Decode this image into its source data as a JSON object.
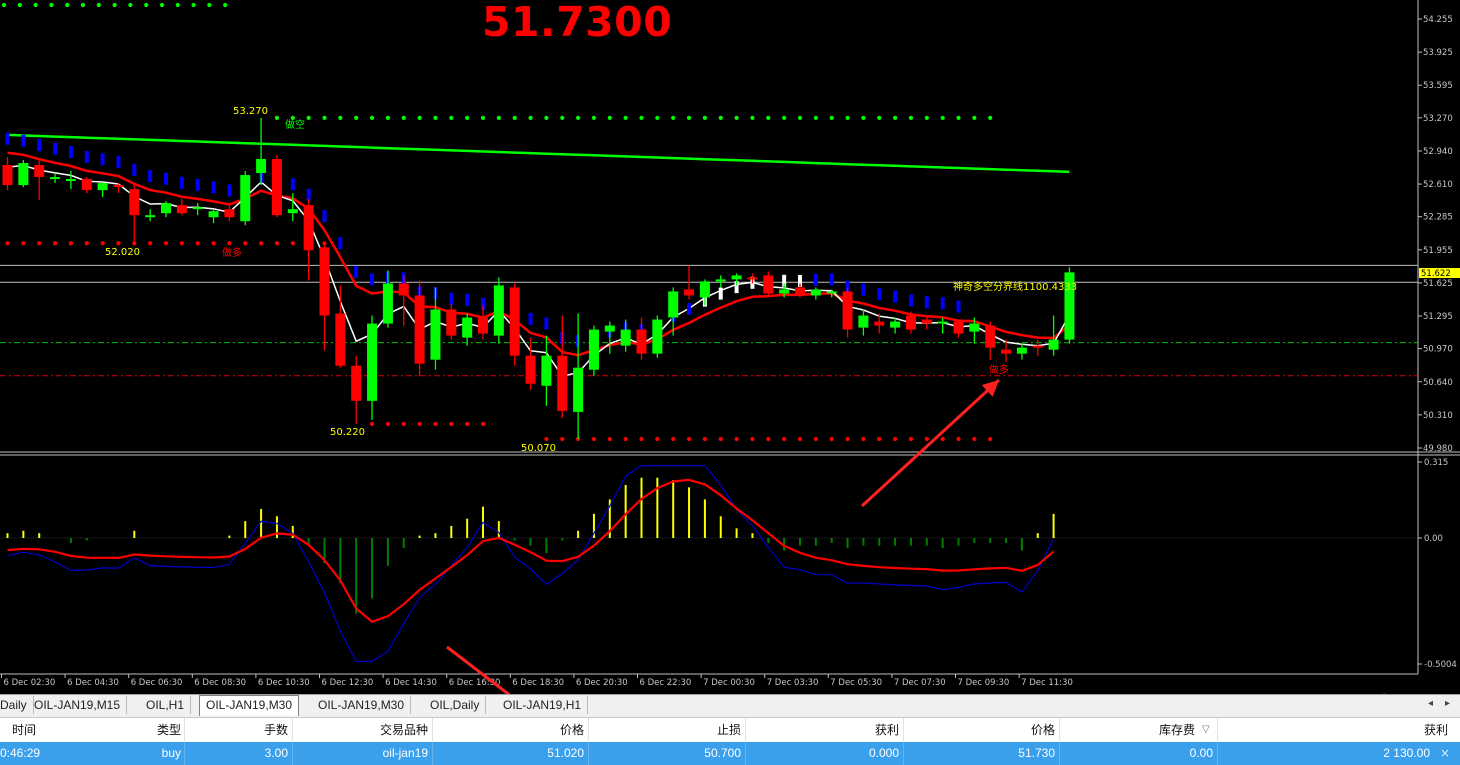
{
  "current_price": "51.7300",
  "colors": {
    "background": "#000000",
    "bull": "#00ff00",
    "bear": "#ff0000",
    "fast_ma": "#ffffff",
    "slow_ma": "#ff0000",
    "long_ma": "#00ff00",
    "blue_bars": "#0000ff",
    "macd_line": "#0000cc",
    "signal_line": "#ff0000",
    "hist_pos": "#ffff00",
    "hist_neg": "#008000",
    "annotation_text": "#ffff00",
    "arrow": "#ff2020",
    "selected_row": "#3ba0ec"
  },
  "price_axis": [
    "54.255",
    "53.925",
    "53.595",
    "53.270",
    "52.940",
    "52.610",
    "52.285",
    "51.955",
    "51.625",
    "51.295",
    "50.970",
    "50.640",
    "50.310",
    "49.980"
  ],
  "price_tag": "51.622",
  "price_tag_top": "51.730",
  "indicator_axis": [
    "0.315",
    "0.00",
    "-0.5004"
  ],
  "time_axis": [
    "6 Dec 02:30",
    "6 Dec 04:30",
    "6 Dec 06:30",
    "6 Dec 08:30",
    "6 Dec 10:30",
    "6 Dec 12:30",
    "6 Dec 14:30",
    "6 Dec 16:30",
    "6 Dec 18:30",
    "6 Dec 20:30",
    "6 Dec 22:30",
    "7 Dec 00:30",
    "7 Dec 03:30",
    "7 Dec 05:30",
    "7 Dec 07:30",
    "7 Dec 09:30",
    "7 Dec 11:30"
  ],
  "annotations": {
    "high_label": "53.270",
    "short_label_1": "做空",
    "low_label_1": "52.020",
    "long_label_1": "做多",
    "low_label_2": "50.220",
    "low_label_3": "50.070",
    "boundary_text": "神奇多空分界线1100.4333",
    "long_label_2": "做多"
  },
  "chart_data": {
    "type": "candlestick",
    "timeframe": "M30",
    "ylim": [
      49.98,
      54.255
    ],
    "candles": [
      {
        "o": 52.8,
        "h": 52.88,
        "l": 52.55,
        "c": 52.6
      },
      {
        "o": 52.6,
        "h": 52.85,
        "l": 52.58,
        "c": 52.82
      },
      {
        "o": 52.8,
        "h": 52.84,
        "l": 52.45,
        "c": 52.68
      },
      {
        "o": 52.68,
        "h": 52.72,
        "l": 52.62,
        "c": 52.68
      },
      {
        "o": 52.66,
        "h": 52.74,
        "l": 52.56,
        "c": 52.66
      },
      {
        "o": 52.66,
        "h": 52.68,
        "l": 52.52,
        "c": 52.55
      },
      {
        "o": 52.55,
        "h": 52.62,
        "l": 52.48,
        "c": 52.62
      },
      {
        "o": 52.6,
        "h": 52.62,
        "l": 52.52,
        "c": 52.58
      },
      {
        "o": 52.56,
        "h": 52.62,
        "l": 52.0,
        "c": 52.3
      },
      {
        "o": 52.3,
        "h": 52.36,
        "l": 52.24,
        "c": 52.3
      },
      {
        "o": 52.32,
        "h": 52.44,
        "l": 52.28,
        "c": 52.42
      },
      {
        "o": 52.4,
        "h": 52.46,
        "l": 52.3,
        "c": 52.32
      },
      {
        "o": 52.38,
        "h": 52.42,
        "l": 52.3,
        "c": 52.38
      },
      {
        "o": 52.28,
        "h": 52.36,
        "l": 52.22,
        "c": 52.34
      },
      {
        "o": 52.36,
        "h": 52.4,
        "l": 52.24,
        "c": 52.28
      },
      {
        "o": 52.24,
        "h": 52.74,
        "l": 52.2,
        "c": 52.7
      },
      {
        "o": 52.72,
        "h": 53.27,
        "l": 52.6,
        "c": 52.86
      },
      {
        "o": 52.86,
        "h": 52.9,
        "l": 52.28,
        "c": 52.3
      },
      {
        "o": 52.32,
        "h": 52.52,
        "l": 52.24,
        "c": 52.36
      },
      {
        "o": 52.4,
        "h": 52.46,
        "l": 51.65,
        "c": 51.95
      },
      {
        "o": 51.98,
        "h": 52.02,
        "l": 50.95,
        "c": 51.3
      },
      {
        "o": 51.32,
        "h": 51.6,
        "l": 50.78,
        "c": 50.8
      },
      {
        "o": 50.8,
        "h": 50.9,
        "l": 50.22,
        "c": 50.45
      },
      {
        "o": 50.45,
        "h": 51.3,
        "l": 50.26,
        "c": 51.22
      },
      {
        "o": 51.22,
        "h": 51.75,
        "l": 51.18,
        "c": 51.62
      },
      {
        "o": 51.62,
        "h": 51.7,
        "l": 51.2,
        "c": 51.5
      },
      {
        "o": 51.5,
        "h": 51.65,
        "l": 50.7,
        "c": 50.82
      },
      {
        "o": 50.86,
        "h": 51.58,
        "l": 50.76,
        "c": 51.36
      },
      {
        "o": 51.36,
        "h": 51.42,
        "l": 51.06,
        "c": 51.1
      },
      {
        "o": 51.08,
        "h": 51.32,
        "l": 51.0,
        "c": 51.28
      },
      {
        "o": 51.28,
        "h": 51.4,
        "l": 51.06,
        "c": 51.12
      },
      {
        "o": 51.1,
        "h": 51.68,
        "l": 51.02,
        "c": 51.6
      },
      {
        "o": 51.58,
        "h": 51.62,
        "l": 50.8,
        "c": 50.9
      },
      {
        "o": 50.9,
        "h": 51.08,
        "l": 50.56,
        "c": 50.62
      },
      {
        "o": 50.6,
        "h": 51.1,
        "l": 50.4,
        "c": 50.9
      },
      {
        "o": 50.9,
        "h": 51.3,
        "l": 50.28,
        "c": 50.35
      },
      {
        "o": 50.34,
        "h": 51.32,
        "l": 50.07,
        "c": 50.78
      },
      {
        "o": 50.76,
        "h": 51.2,
        "l": 50.7,
        "c": 51.16
      },
      {
        "o": 51.14,
        "h": 51.24,
        "l": 50.92,
        "c": 51.2
      },
      {
        "o": 51.0,
        "h": 51.26,
        "l": 50.94,
        "c": 51.16
      },
      {
        "o": 51.16,
        "h": 51.28,
        "l": 50.86,
        "c": 50.92
      },
      {
        "o": 50.92,
        "h": 51.3,
        "l": 50.88,
        "c": 51.26
      },
      {
        "o": 51.28,
        "h": 51.58,
        "l": 51.1,
        "c": 51.54
      },
      {
        "o": 51.56,
        "h": 51.8,
        "l": 51.46,
        "c": 51.5
      },
      {
        "o": 51.48,
        "h": 51.66,
        "l": 51.4,
        "c": 51.64
      },
      {
        "o": 51.64,
        "h": 51.7,
        "l": 51.58,
        "c": 51.66
      },
      {
        "o": 51.66,
        "h": 51.72,
        "l": 51.6,
        "c": 51.7
      },
      {
        "o": 51.68,
        "h": 51.72,
        "l": 51.62,
        "c": 51.66
      },
      {
        "o": 51.7,
        "h": 51.74,
        "l": 51.5,
        "c": 51.52
      },
      {
        "o": 51.52,
        "h": 51.62,
        "l": 51.48,
        "c": 51.56
      },
      {
        "o": 51.58,
        "h": 51.62,
        "l": 51.48,
        "c": 51.5
      },
      {
        "o": 51.5,
        "h": 51.58,
        "l": 51.46,
        "c": 51.56
      },
      {
        "o": 51.52,
        "h": 51.56,
        "l": 51.48,
        "c": 51.54
      },
      {
        "o": 51.54,
        "h": 51.58,
        "l": 51.08,
        "c": 51.16
      },
      {
        "o": 51.18,
        "h": 51.36,
        "l": 51.1,
        "c": 51.3
      },
      {
        "o": 51.24,
        "h": 51.32,
        "l": 51.12,
        "c": 51.2
      },
      {
        "o": 51.18,
        "h": 51.28,
        "l": 51.12,
        "c": 51.24
      },
      {
        "o": 51.3,
        "h": 51.34,
        "l": 51.12,
        "c": 51.16
      },
      {
        "o": 51.26,
        "h": 51.3,
        "l": 51.16,
        "c": 51.22
      },
      {
        "o": 51.22,
        "h": 51.28,
        "l": 51.12,
        "c": 51.24
      },
      {
        "o": 51.24,
        "h": 51.26,
        "l": 51.08,
        "c": 51.12
      },
      {
        "o": 51.14,
        "h": 51.28,
        "l": 51.02,
        "c": 51.22
      },
      {
        "o": 51.2,
        "h": 51.24,
        "l": 50.86,
        "c": 50.98
      },
      {
        "o": 50.96,
        "h": 51.06,
        "l": 50.84,
        "c": 50.92
      },
      {
        "o": 50.92,
        "h": 51.02,
        "l": 50.86,
        "c": 50.98
      },
      {
        "o": 51.0,
        "h": 51.06,
        "l": 50.9,
        "c": 50.98
      },
      {
        "o": 50.96,
        "h": 51.3,
        "l": 50.9,
        "c": 51.06
      },
      {
        "o": 51.06,
        "h": 51.78,
        "l": 51.02,
        "c": 51.73
      }
    ],
    "stop_dots_upper": {
      "value": 53.27,
      "from_index": 17,
      "to_index": 62
    },
    "stop_dots_lower_1": {
      "value": 52.02,
      "from_index": 0,
      "to_index": 20
    },
    "stop_dots_lower_2": {
      "value": 50.22,
      "from_index": 23,
      "to_index": 30
    },
    "stop_dots_lower_3": {
      "value": 50.07,
      "from_index": 34,
      "to_index": 62
    },
    "current_line": 51.73,
    "boundary_line": 51.622,
    "entry_line": 51.02,
    "stop_line": 50.7,
    "indicator_ylim": [
      -0.5004,
      0.315
    ],
    "histogram": [
      0.02,
      0.03,
      0.02,
      0.0,
      -0.02,
      -0.01,
      0.0,
      0.0,
      0.03,
      0.0,
      0.0,
      0.0,
      0.0,
      0.0,
      0.01,
      0.07,
      0.12,
      0.09,
      0.05,
      -0.03,
      -0.1,
      -0.18,
      -0.3,
      -0.24,
      -0.11,
      -0.04,
      0.01,
      0.02,
      0.05,
      0.08,
      0.13,
      0.07,
      -0.01,
      -0.03,
      -0.06,
      -0.01,
      0.03,
      0.1,
      0.16,
      0.22,
      0.25,
      0.25,
      0.24,
      0.21,
      0.16,
      0.09,
      0.04,
      0.02,
      -0.02,
      -0.05,
      -0.03,
      -0.03,
      -0.02,
      -0.04,
      -0.03,
      -0.03,
      -0.03,
      -0.03,
      -0.03,
      -0.04,
      -0.03,
      -0.02,
      -0.02,
      -0.02,
      -0.05,
      0.02,
      0.1
    ]
  },
  "tabs": [
    "Daily",
    "OIL-JAN19,M15",
    "OIL,H1",
    "OIL-JAN19,M30",
    "OIL-JAN19,M30",
    "OIL,Daily",
    "OIL-JAN19,H1"
  ],
  "active_tab_index": 3,
  "table": {
    "headers": [
      "时间",
      "类型",
      "手数",
      "交易品种",
      "价格",
      "止损",
      "获利",
      "价格",
      "库存费",
      "获利"
    ],
    "row": [
      "0:46:29",
      "buy",
      "3.00",
      "oil-jan19",
      "51.020",
      "50.700",
      "0.000",
      "51.730",
      "0.00",
      "2 130.00"
    ],
    "sort_glyph": "▽",
    "close_glyph": "×"
  }
}
